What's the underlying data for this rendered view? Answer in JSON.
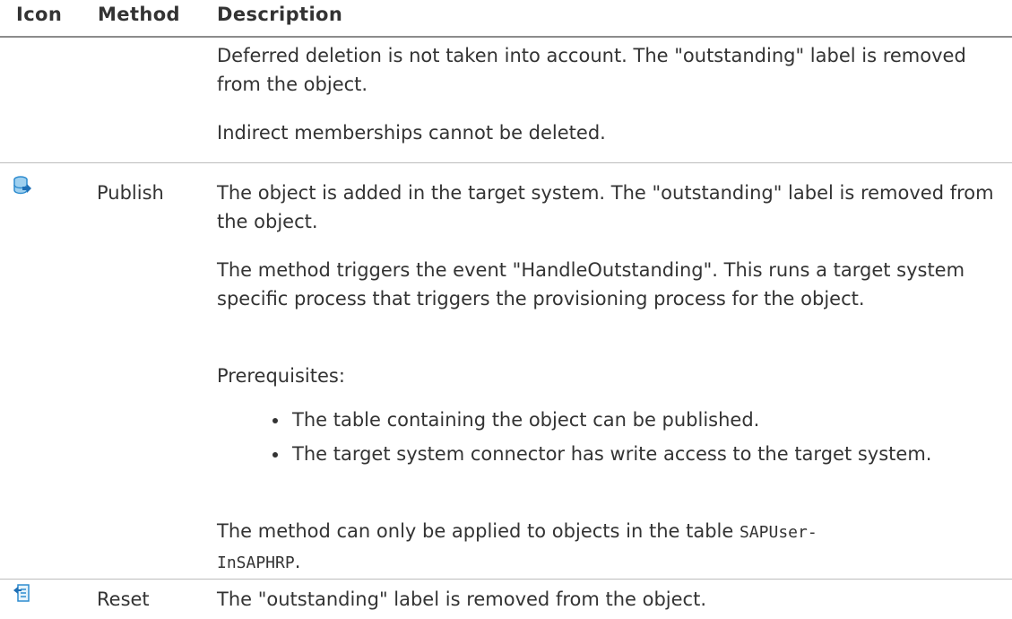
{
  "table": {
    "headers": {
      "icon": "Icon",
      "method": "Method",
      "description": "Description"
    },
    "rows": [
      {
        "method": "",
        "paragraphs": [
          "Deferred deletion is not taken into account. The \"outstanding\" label is removed from the object.",
          "Indirect memberships cannot be deleted."
        ]
      },
      {
        "icon": "publish-database-icon",
        "method": "Publish",
        "paragraphs": [
          "The object is added in the target system. The \"outstanding\" label is removed from the object.",
          "The method triggers the event \"HandleOutstanding\". This runs a target system specific process that triggers the provisioning process for the object.",
          "Prerequisites:"
        ],
        "bullets": [
          "The table containing the object can be published.",
          "The target system connector has write access to the target system."
        ],
        "closing_text": "The method can only be applied to objects in the table ",
        "closing_code_line1": "SAPUser-",
        "closing_code_line2": "InSAPHRP",
        "closing_end": "."
      },
      {
        "icon": "reset-document-icon",
        "method": "Reset",
        "paragraphs": [
          "The \"outstanding\" label is removed from the object."
        ]
      }
    ]
  },
  "colors": {
    "icon_blue": "#2e8ccf",
    "icon_light": "#9fd0ef",
    "arrow_blue": "#1f6fb5"
  }
}
